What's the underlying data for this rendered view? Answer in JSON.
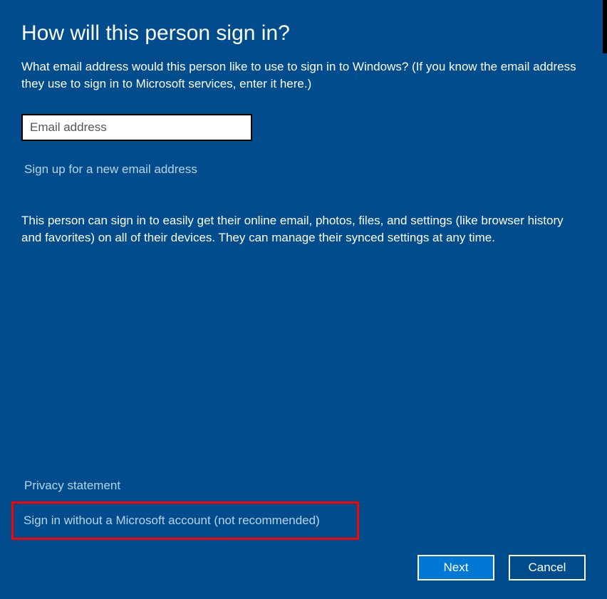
{
  "title": "How will this person sign in?",
  "subtitle": "What email address would this person like to use to sign in to Windows? (If you know the email address they use to sign in to Microsoft services, enter it here.)",
  "email": {
    "placeholder": "Email address",
    "value": ""
  },
  "signup_link": "Sign up for a new email address",
  "description": "This person can sign in to easily get their online email, photos, files, and settings (like browser history and favorites) on all of their devices. They can manage their synced settings at any time.",
  "privacy_link": "Privacy statement",
  "signin_without_link": "Sign in without a Microsoft account (not recommended)",
  "buttons": {
    "next": "Next",
    "cancel": "Cancel"
  }
}
